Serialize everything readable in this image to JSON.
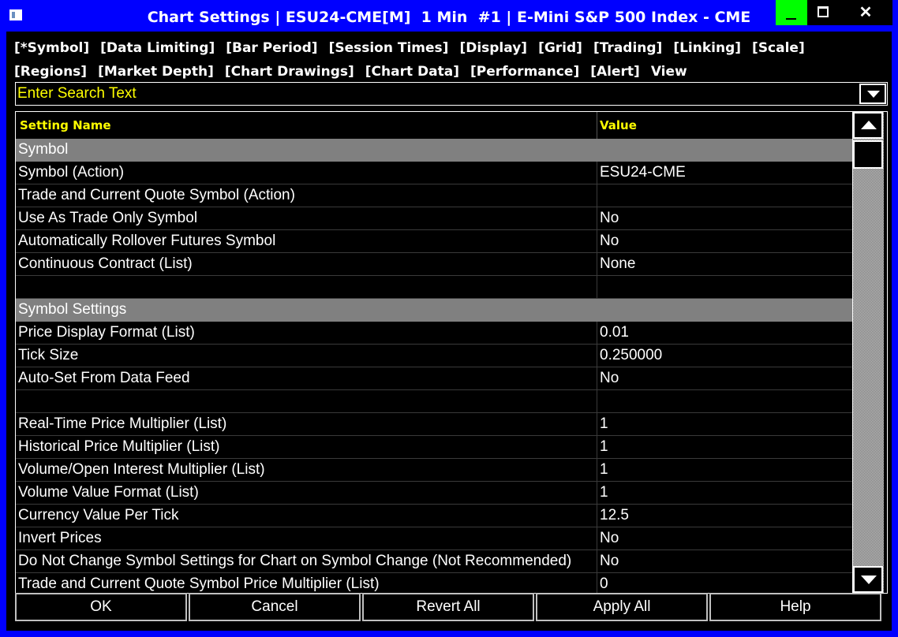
{
  "window": {
    "title": "Chart Settings | ESU24-CME[M]  1 Min  #1 | E-Mini S&P 500 Index - CME",
    "close_glyph": "✕",
    "colors": {
      "titlebar": "#0000ff",
      "minimize": "#00ff00",
      "section": "#808080",
      "header_text": "#ffff00"
    }
  },
  "tabs": [
    "[*Symbol]",
    "[Data Limiting]",
    "[Bar Period]",
    "[Session Times]",
    "[Display]",
    "[Grid]",
    "[Trading]",
    "[Linking]",
    "[Scale]",
    "[Regions]",
    "[Market Depth]",
    "[Chart Drawings]",
    "[Chart Data]",
    "[Performance]",
    "[Alert]",
    "View"
  ],
  "search": {
    "placeholder": "Enter Search Text",
    "value": ""
  },
  "grid": {
    "headers": {
      "name": "Setting Name",
      "value": "Value"
    },
    "rows": [
      {
        "type": "section",
        "name": "Symbol",
        "value": ""
      },
      {
        "type": "item",
        "name": "Symbol (Action)",
        "value": "ESU24-CME"
      },
      {
        "type": "item",
        "name": "Trade and Current Quote Symbol (Action)",
        "value": ""
      },
      {
        "type": "item",
        "name": "Use As Trade Only Symbol",
        "value": "No"
      },
      {
        "type": "item",
        "name": "Automatically Rollover Futures Symbol",
        "value": "No"
      },
      {
        "type": "item",
        "name": "Continuous Contract (List)",
        "value": "None"
      },
      {
        "type": "item",
        "name": "",
        "value": ""
      },
      {
        "type": "section",
        "name": "Symbol Settings",
        "value": ""
      },
      {
        "type": "item",
        "name": "Price Display Format (List)",
        "value": "0.01"
      },
      {
        "type": "item",
        "name": "Tick Size",
        "value": "0.250000"
      },
      {
        "type": "item",
        "name": "Auto-Set From Data Feed",
        "value": "No"
      },
      {
        "type": "item",
        "name": "",
        "value": ""
      },
      {
        "type": "item",
        "name": "Real-Time Price Multiplier (List)",
        "value": "1"
      },
      {
        "type": "item",
        "name": "Historical Price Multiplier (List)",
        "value": "1"
      },
      {
        "type": "item",
        "name": "Volume/Open Interest Multiplier (List)",
        "value": "1"
      },
      {
        "type": "item",
        "name": "Volume Value Format (List)",
        "value": "1"
      },
      {
        "type": "item",
        "name": "Currency Value Per Tick",
        "value": "12.5"
      },
      {
        "type": "item",
        "name": "Invert Prices",
        "value": "No"
      },
      {
        "type": "item",
        "name": "Do Not Change Symbol Settings for Chart on Symbol Change (Not Recommended)",
        "value": "No"
      },
      {
        "type": "item",
        "name": "Trade and Current Quote Symbol Price Multiplier (List)",
        "value": "0"
      }
    ]
  },
  "buttons": [
    "OK",
    "Cancel",
    "Revert All",
    "Apply All",
    "Help"
  ]
}
